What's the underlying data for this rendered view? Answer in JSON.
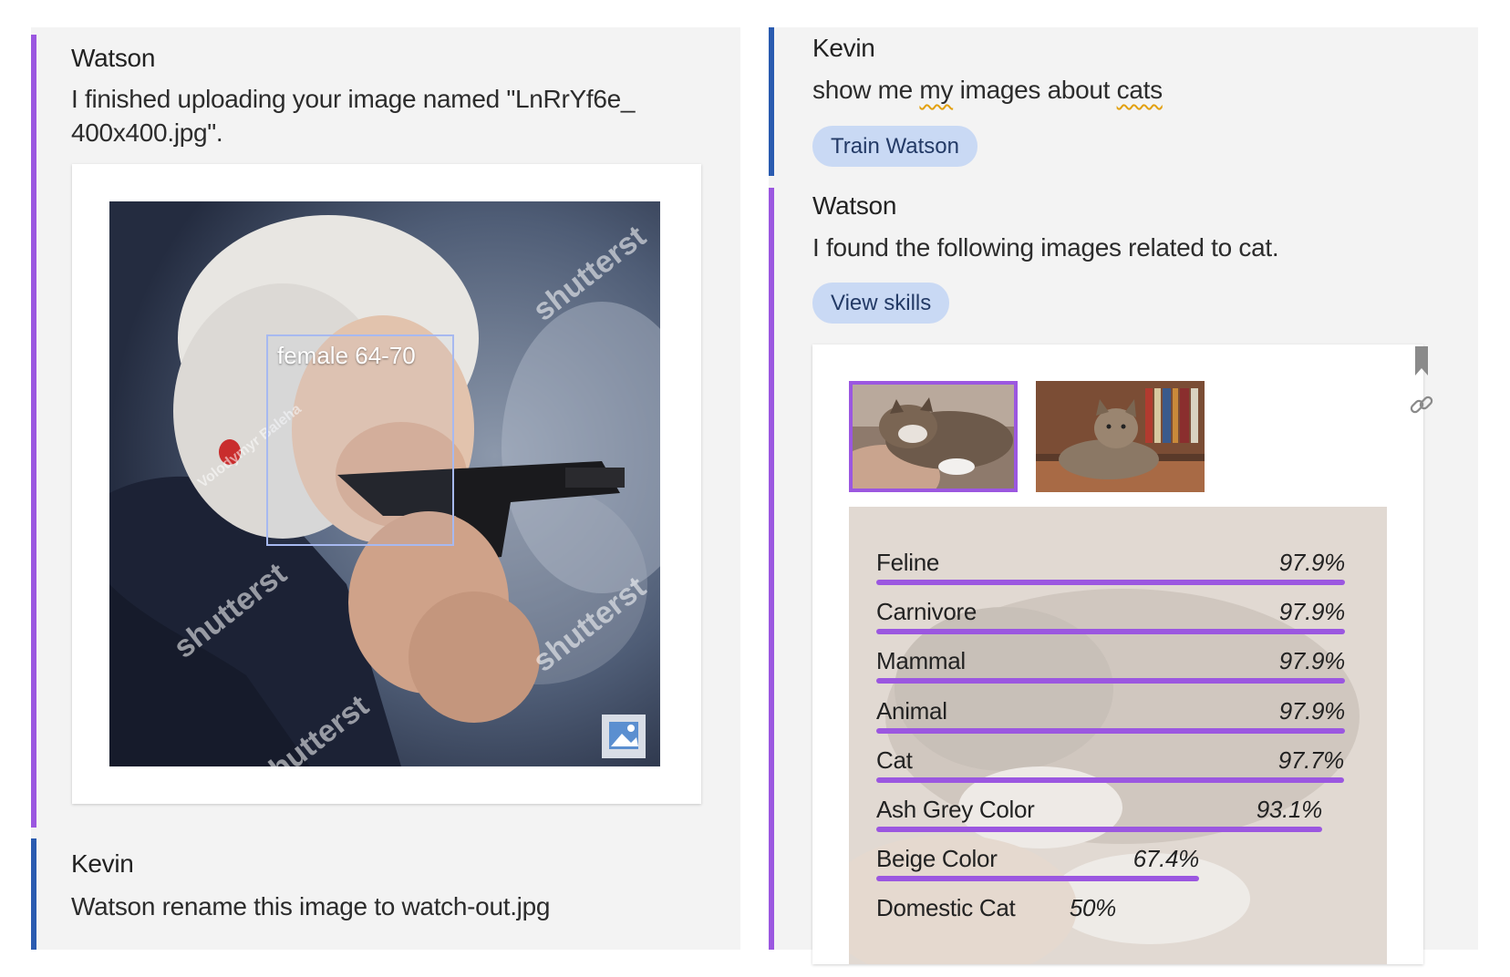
{
  "left_panel": {
    "watson_message": {
      "sender": "Watson",
      "text": "I finished uploading your image named \"LnRrYf6e_ 400x400.jpg\".",
      "image": {
        "face_label": "female 64-70",
        "watermarks": [
          "shutterst",
          "shutterst",
          "shutterst",
          "shutterst",
          "Volodymyr Baleha"
        ]
      }
    },
    "kevin_message": {
      "sender": "Kevin",
      "text": "Watson rename this image to watch-out.jpg"
    }
  },
  "right_panel": {
    "kevin_message": {
      "sender": "Kevin",
      "text_parts": [
        "show me ",
        "my",
        " images about ",
        "cats"
      ],
      "chip_label": "Train Watson"
    },
    "watson_message": {
      "sender": "Watson",
      "text": "I found the following images related to cat.",
      "chip_label": "View skills",
      "thumbnails": [
        {
          "name": "cat-sleeping-on-pillow",
          "selected": true
        },
        {
          "name": "cat-sitting-by-bookshelf",
          "selected": false
        }
      ],
      "tags": [
        {
          "label": "Feline",
          "score": "97.9%",
          "value": 0.979
        },
        {
          "label": "Carnivore",
          "score": "97.9%",
          "value": 0.979
        },
        {
          "label": "Mammal",
          "score": "97.9%",
          "value": 0.979
        },
        {
          "label": "Animal",
          "score": "97.9%",
          "value": 0.979
        },
        {
          "label": "Cat",
          "score": "97.7%",
          "value": 0.977
        },
        {
          "label": "Ash Grey Color",
          "score": "93.1%",
          "value": 0.931
        },
        {
          "label": "Beige Color",
          "score": "67.4%",
          "value": 0.674
        },
        {
          "label": "Domestic Cat",
          "score": "50%",
          "value": 0.5
        }
      ]
    }
  },
  "colors": {
    "watson_accent": "#9b57e0",
    "kevin_accent": "#2a5bb0",
    "chip_background": "#c9d9f4",
    "panel_background": "#f3f3f3"
  },
  "icons": [
    "image-placeholder-icon",
    "bookmark-icon",
    "link-icon"
  ]
}
